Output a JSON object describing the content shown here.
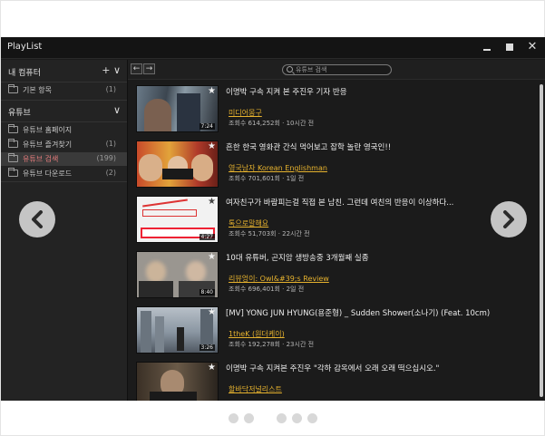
{
  "window": {
    "title": "PlayList"
  },
  "sidebar": {
    "section1": {
      "label": "내 컴퓨터",
      "controls": "+ ∨"
    },
    "section1_items": [
      {
        "label": "기본 항목",
        "count": "(1)"
      }
    ],
    "section2": {
      "label": "유튜브",
      "controls": "∨"
    },
    "section2_items": [
      {
        "label": "유튜브 홈페이지",
        "count": ""
      },
      {
        "label": "유튜브 즐겨찾기",
        "count": "(1)"
      },
      {
        "label": "유튜브 검색",
        "count": "(199)"
      },
      {
        "label": "유튜브 다운로드",
        "count": "(2)"
      }
    ]
  },
  "toolbar": {
    "back": "←",
    "forward": "→",
    "search_placeholder": "유튜브 검색"
  },
  "videos": [
    {
      "title": "이명박 구속 지켜 본 주진우 기자 반응",
      "channel": "미디어몽구",
      "meta": "조회수 614,252회 · 10시간 전",
      "duration": "7:24"
    },
    {
      "title": "흔한 한국 영화관 간식 먹어보고 잡학 놀란 영국인!!",
      "channel": "영국남자 Korean Englishman",
      "meta": "조회수 701,601회 · 1일 전",
      "duration": ""
    },
    {
      "title": "여자친구가 바람피는걸 직접 본 남친. 그런데 여친의 반응이 이상하다...",
      "channel": "톡으로말해요",
      "meta": "조회수 51,703회 · 22시간 전",
      "duration": "4:27"
    },
    {
      "title": "10대 유튜버, 곤지암 생방송중 3개월째 실종",
      "channel": "리뷰엉이: Owl&#39;s Review",
      "meta": "조회수 696,401회 · 2일 전",
      "duration": "8:40"
    },
    {
      "title": "[MV] YONG JUN HYUNG(용준형) _ Sudden Shower(소나기) (Feat. 10cm)",
      "channel": "1theK (원더케이)",
      "meta": "조회수 192,278회 · 23시간 전",
      "duration": "3:26"
    },
    {
      "title": "이명박 구속 지켜본 주진우 \"각하 감옥에서 오래 오래 떡으십시오.\"",
      "channel": "할바닥저널리스트",
      "meta": "",
      "duration": ""
    }
  ],
  "colors": {
    "channel": "#e6b22e",
    "selected_label": "#ea7d7d",
    "app_bg": "#1b1b1b"
  }
}
